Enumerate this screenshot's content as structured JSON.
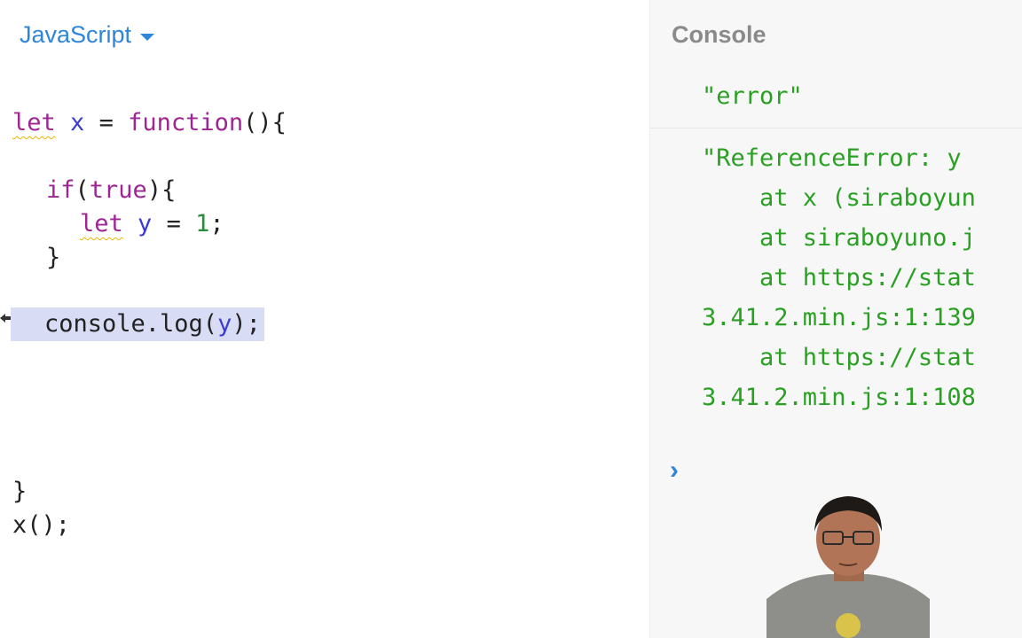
{
  "editor": {
    "language": "JavaScript",
    "code": {
      "l1": {
        "kw": "let",
        "id": "x",
        "eq": " = ",
        "fn": "function",
        "rest": "(){"
      },
      "l2": {
        "kw": "if",
        "rest1": "(",
        "kw2": "true",
        "rest2": "){"
      },
      "l3": {
        "kw": "let",
        "id": "y",
        "eq": " = ",
        "num": "1",
        "rest": ";"
      },
      "l4": "}",
      "l5": {
        "pre": "console.log(",
        "id": "y",
        "post": ");"
      },
      "l6": "}",
      "l7": "x();"
    }
  },
  "console": {
    "title": "Console",
    "entry1": "\"error\"",
    "entry2_lines": [
      "\"ReferenceError: y",
      "    at x (siraboyun",
      "    at siraboyuno.j",
      "    at https://stat",
      "3.41.2.min.js:1:139",
      "    at https://stat",
      "3.41.2.min.js:1:108"
    ],
    "prompt_icon": "chevron-right-icon"
  }
}
